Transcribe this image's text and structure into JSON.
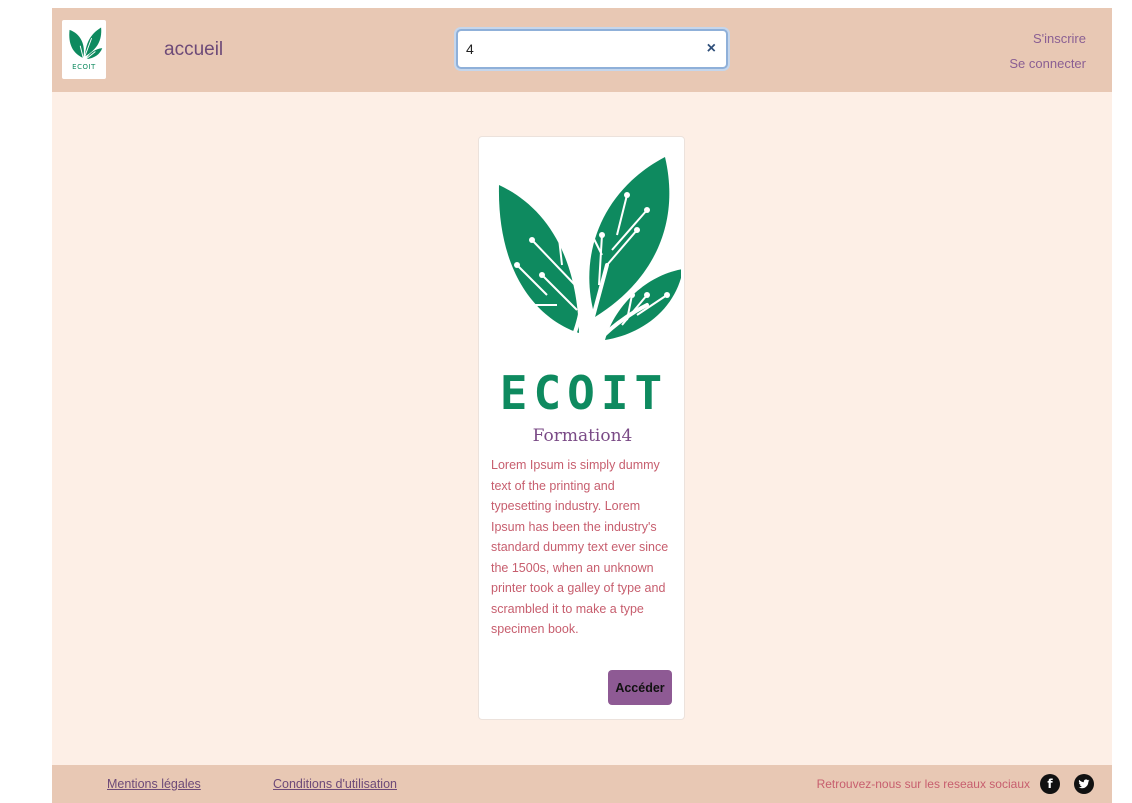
{
  "header": {
    "logo_text": "ECOIT",
    "home_link": "accueil",
    "search": {
      "value": "4",
      "clear_icon": "close-icon"
    },
    "auth": {
      "signup": "S'inscrire",
      "login": "Se connecter"
    }
  },
  "card": {
    "logo_text": "ECOIT",
    "title": "Formation4",
    "description": "Lorem Ipsum is simply dummy text of the printing and typesetting industry. Lorem Ipsum has been the industry's standard dummy text ever since the 1500s, when an unknown printer took a galley of type and scrambled it to make a type specimen book.",
    "button": "Accéder"
  },
  "footer": {
    "legal": "Mentions légales",
    "terms": "Conditions d'utilisation",
    "social_text": "Retrouvez-nous sur les reseaux sociaux",
    "social_icons": [
      "facebook-icon",
      "twitter-icon"
    ]
  },
  "colors": {
    "header_bg": "#e8c8b4",
    "page_bg": "#fdefe6",
    "brand_green": "#0e8a5f",
    "accent_purple": "#8e5a94",
    "desc_text": "#c75e6e"
  }
}
